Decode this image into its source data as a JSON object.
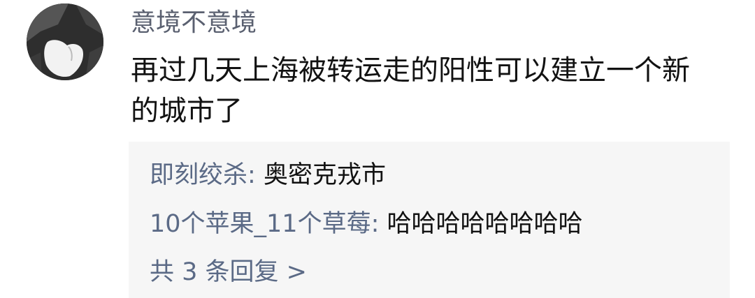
{
  "comment": {
    "author": "意境不意境",
    "lines": [
      "再过几天上海被转运走的阳性可以建立一个新",
      "的城市了"
    ]
  },
  "replies": [
    {
      "author": "即刻绞杀",
      "separator": ": ",
      "text": "奥密克戎市"
    },
    {
      "author": "10个苹果_11个草莓",
      "separator": ": ",
      "text": "哈哈哈哈哈哈哈哈"
    }
  ],
  "more_replies": {
    "label": "共 3 条回复 >"
  }
}
